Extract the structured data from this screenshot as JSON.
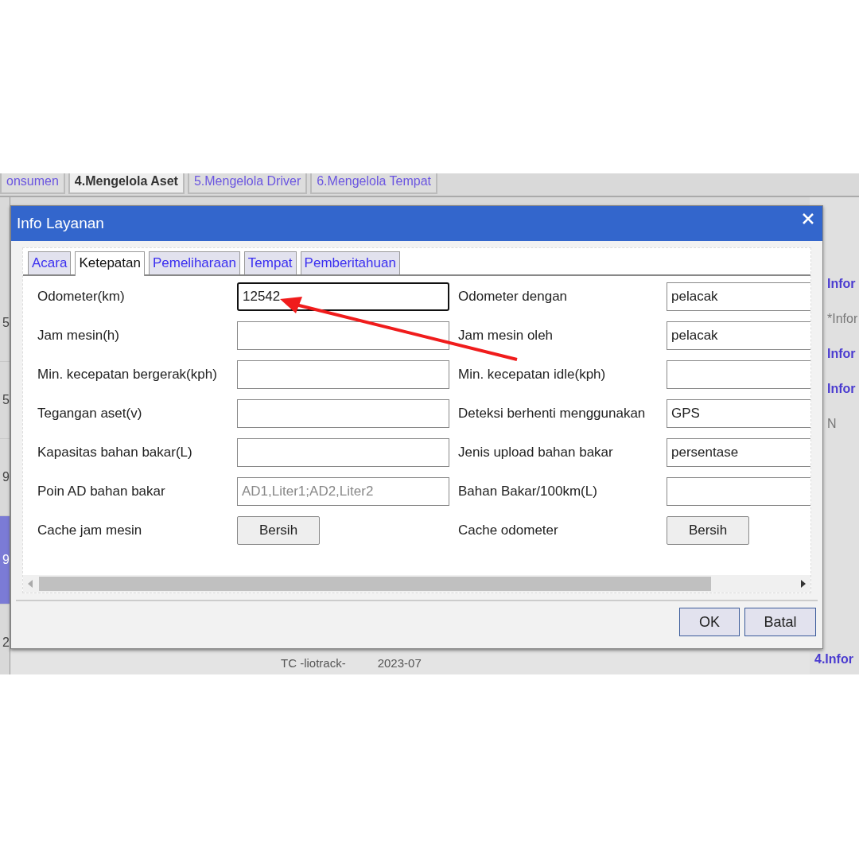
{
  "background": {
    "tabs": [
      {
        "label": "onsumen",
        "selected": false
      },
      {
        "label": "4.Mengelola Aset",
        "selected": true
      },
      {
        "label": "5.Mengelola Driver",
        "selected": false
      },
      {
        "label": "6.Mengelola Tempat",
        "selected": false
      }
    ],
    "left_cells": [
      {
        "text": "5",
        "selected": false
      },
      {
        "text": "5",
        "selected": false
      },
      {
        "text": "9",
        "selected": false
      },
      {
        "text": "9",
        "selected": true
      },
      {
        "text": "2",
        "selected": false
      }
    ],
    "right_panel": [
      {
        "text": "Infor",
        "kind": "heading"
      },
      {
        "text": "*Infor",
        "kind": "note"
      },
      {
        "text": "Infor",
        "kind": "heading"
      },
      {
        "text": "Infor",
        "kind": "heading"
      },
      {
        "text": "N",
        "kind": "note"
      },
      {
        "text": "4.Infor",
        "kind": "heading"
      }
    ],
    "bottom_cells": [
      "TC -liotrack-",
      "2023-07"
    ]
  },
  "dialog": {
    "title": "Info Layanan",
    "tabs": [
      {
        "label": "Acara",
        "selected": false
      },
      {
        "label": "Ketepatan",
        "selected": true
      },
      {
        "label": "Pemeliharaan",
        "selected": false
      },
      {
        "label": "Tempat",
        "selected": false
      },
      {
        "label": "Pemberitahuan",
        "selected": false
      }
    ],
    "rows": [
      {
        "left": {
          "label": "Odometer(km)",
          "kind": "input",
          "value": "12542",
          "focused": true
        },
        "right": {
          "label": "Odometer dengan",
          "kind": "input",
          "value": "pelacak",
          "focused": false
        }
      },
      {
        "left": {
          "label": "Jam mesin(h)",
          "kind": "input",
          "focused": false
        },
        "right": {
          "label": "Jam mesin oleh",
          "kind": "input",
          "value": "pelacak",
          "focused": false
        }
      },
      {
        "left": {
          "label": "Min. kecepatan bergerak(kph)",
          "kind": "input",
          "focused": false
        },
        "right": {
          "label": "Min. kecepatan idle(kph)",
          "kind": "input",
          "focused": false
        }
      },
      {
        "left": {
          "label": "Tegangan aset(v)",
          "kind": "input",
          "focused": false
        },
        "right": {
          "label": "Deteksi berhenti menggunakan",
          "kind": "input",
          "value": "GPS",
          "focused": false
        }
      },
      {
        "left": {
          "label": "Kapasitas bahan bakar(L)",
          "kind": "input",
          "focused": false
        },
        "right": {
          "label": "Jenis upload bahan bakar",
          "kind": "input",
          "value": "persentase",
          "focused": false
        }
      },
      {
        "left": {
          "label": "Poin AD bahan bakar",
          "kind": "input",
          "placeholder": "AD1,Liter1;AD2,Liter2",
          "focused": false
        },
        "right": {
          "label": "Bahan Bakar/100km(L)",
          "kind": "input",
          "focused": false
        }
      },
      {
        "left": {
          "label": "Cache jam mesin",
          "kind": "button",
          "value": "Bersih"
        },
        "right": {
          "label": "Cache odometer",
          "kind": "button",
          "value": "Bersih"
        }
      }
    ],
    "buttons": [
      "OK",
      "Batal"
    ]
  }
}
